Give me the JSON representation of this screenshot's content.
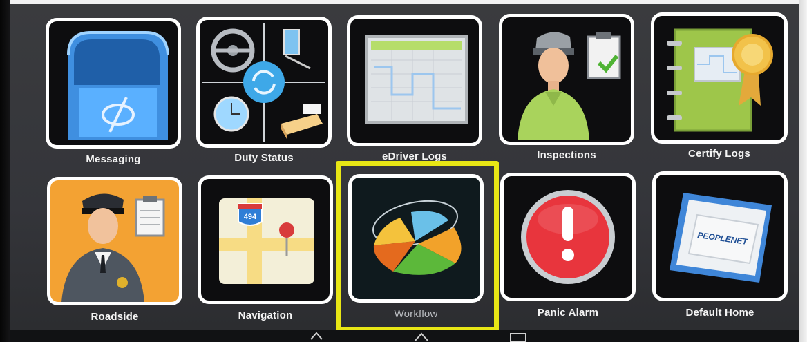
{
  "apps": [
    {
      "label": "Messaging",
      "icon": "mailbox-icon"
    },
    {
      "label": "Duty Status",
      "icon": "duty-status-icon"
    },
    {
      "label": "eDriver Logs",
      "icon": "log-grid-icon"
    },
    {
      "label": "Inspections",
      "icon": "inspector-icon"
    },
    {
      "label": "Certify Logs",
      "icon": "certify-notebook-icon"
    },
    {
      "label": "Roadside",
      "icon": "officer-icon"
    },
    {
      "label": "Navigation",
      "icon": "map-pin-icon"
    },
    {
      "label": "Workflow",
      "icon": "pie-chart-icon"
    },
    {
      "label": "Panic Alarm",
      "icon": "alarm-icon"
    },
    {
      "label": "Default Home",
      "icon": "peoplenet-chip-icon"
    }
  ],
  "selected_app": "Workflow",
  "highlight_color": "#e8e615",
  "map_route_number": "494",
  "brand_text": "PEOPLENET"
}
